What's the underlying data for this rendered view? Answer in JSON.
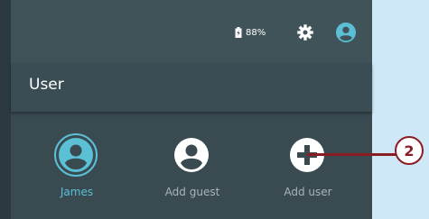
{
  "status_bar": {
    "battery_text": "88%",
    "icons": [
      "battery-icon",
      "gear-icon",
      "account-icon"
    ]
  },
  "header": {
    "title": "User"
  },
  "users": [
    {
      "label": "James",
      "icon": "user-avatar-icon",
      "active": true
    },
    {
      "label": "Add guest",
      "icon": "guest-avatar-icon",
      "active": false
    },
    {
      "label": "Add user",
      "icon": "plus-icon",
      "active": false
    }
  ],
  "callout": {
    "number": "2"
  },
  "colors": {
    "background": "#cfe8f7",
    "panel": "#394a51",
    "accent": "#5bc0d6",
    "callout": "#8a1c24"
  }
}
